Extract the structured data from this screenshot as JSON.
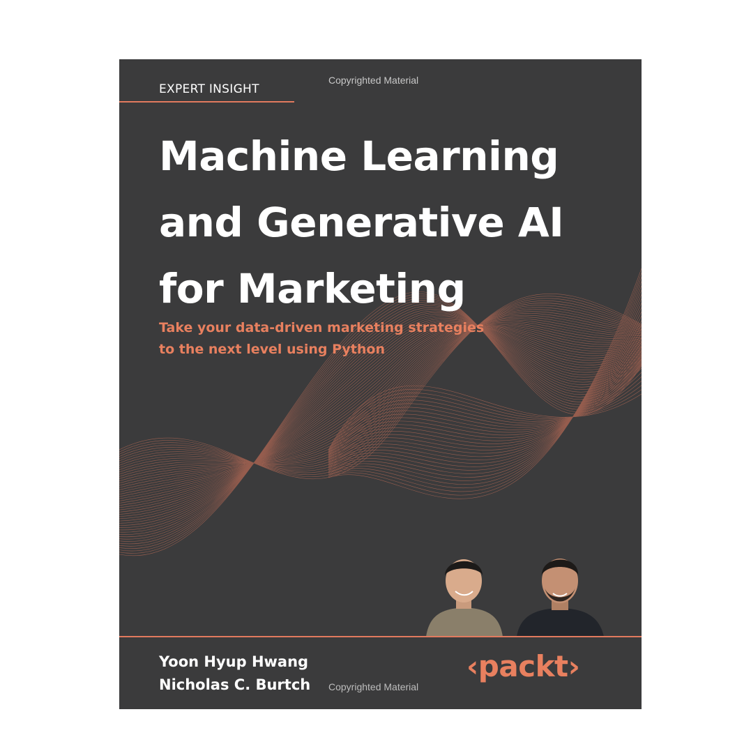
{
  "cover": {
    "series_label": "EXPERT INSIGHT",
    "watermark_top": "Copyrighted Material",
    "title_lines": [
      "Machine Learning",
      "and Generative AI",
      "for Marketing"
    ],
    "subtitle_lines": [
      "Take your data-driven marketing strategies",
      "to the next level using Python"
    ],
    "authors": [
      "Yoon Hyup Hwang",
      "Nicholas C. Burtch"
    ],
    "watermark_bottom": "Copyrighted Material",
    "publisher": "‹packt›"
  },
  "colors": {
    "background": "#3b3b3c",
    "accent": "#e27a5e",
    "text": "#ffffff"
  }
}
